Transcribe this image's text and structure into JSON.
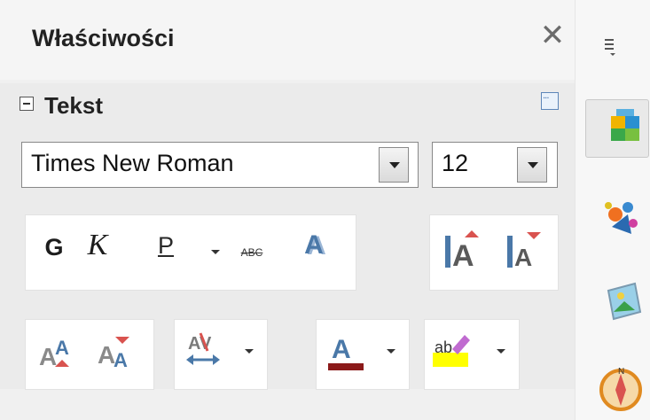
{
  "panel": {
    "title": "Właściwości",
    "close_glyph": "✕"
  },
  "section": {
    "title": "Tekst",
    "collapse_state": "expanded",
    "more_options_icon": "more-options-icon"
  },
  "font": {
    "name": "Times New Roman",
    "size": "12"
  },
  "toolbar": {
    "bold_label": "G",
    "italic_label": "K",
    "underline_label": "P",
    "strikethrough_label": "ABC",
    "shadow_label": "A",
    "increase_size_label": "A",
    "decrease_size_label": "A",
    "superscript_label": "A",
    "subscript_label": "A",
    "spacing_label": "AV",
    "font_color_label": "A",
    "highlight_label": "ab"
  },
  "colors": {
    "font_color": "#8b1a1a",
    "highlight_color": "#ffff00",
    "accent": "#4a78a8",
    "red": "#d9534f"
  },
  "sidebar": {
    "items": [
      {
        "name": "properties",
        "icon": "properties-icon",
        "active": true
      },
      {
        "name": "styles",
        "icon": "styles-icon",
        "active": false
      },
      {
        "name": "gallery",
        "icon": "gallery-icon",
        "active": false
      },
      {
        "name": "navigator",
        "icon": "navigator-icon",
        "active": false
      }
    ]
  }
}
